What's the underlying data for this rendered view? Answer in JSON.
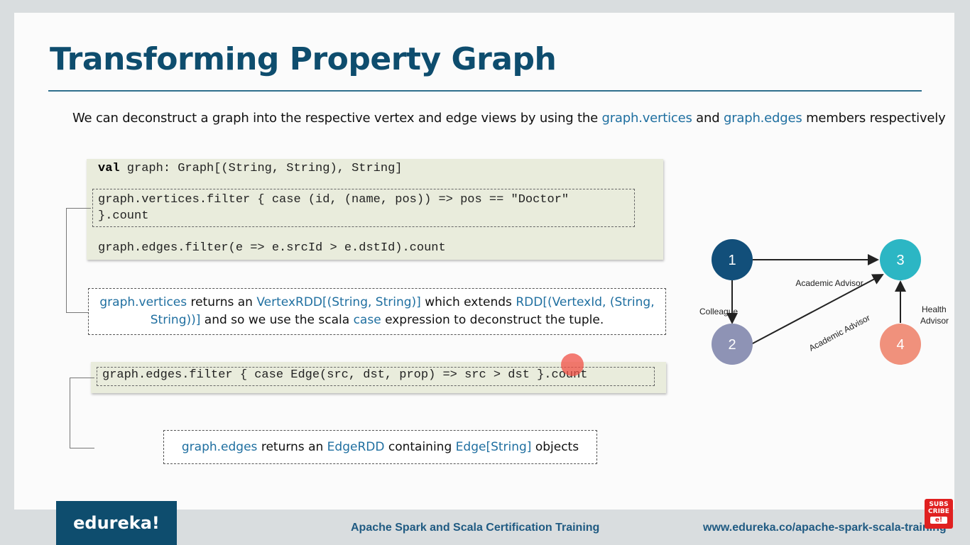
{
  "slide": {
    "title": "Transforming Property Graph",
    "intro": {
      "part1": "We can deconstruct a graph into the respective vertex and edge views by using the ",
      "link1": "graph.vertices",
      "part2": " and ",
      "link2": "graph.edges",
      "part3": " members respectively"
    },
    "code_block_1": {
      "line1_kw": "val",
      "line1_rest": " graph: Graph[(String, String), String]",
      "line2": "graph.vertices.filter { case (id, (name, pos)) => pos == \"Doctor\"",
      "line3": "}.count",
      "line4": "graph.edges.filter(e => e.srcId > e.dstId).count"
    },
    "note_1": {
      "t1": "graph.vertices",
      "t2": " returns an ",
      "t3": "VertexRDD[(String, String)]",
      "t4": " which extends ",
      "t5": "RDD[(VertexId, (String,",
      "t6": "String))]",
      "t7": " and so we use the scala ",
      "t8": "case",
      "t9": " expression to deconstruct the tuple."
    },
    "code_block_2": {
      "line1": "graph.edges.filter { case Edge(src, dst, prop) => src > dst }.count"
    },
    "note_2": {
      "t1": "graph.edges",
      "t2": " returns an ",
      "t3": "EdgeRDD",
      "t4": " containing ",
      "t5": "Edge[String]",
      "t6": " objects"
    },
    "graph": {
      "nodes": [
        {
          "label": "1",
          "color": "#124f7a"
        },
        {
          "label": "2",
          "color": "#8e93b5"
        },
        {
          "label": "3",
          "color": "#2cb6c4"
        },
        {
          "label": "4",
          "color": "#f0917c"
        }
      ],
      "edge_labels": {
        "e13": "Academic Advisor",
        "e12": "Colleague",
        "e23": "Academic Advisor",
        "e43_line1": "Health",
        "e43_line2": "Advisor"
      }
    }
  },
  "footer": {
    "logo": "edureka!",
    "course": "Apache Spark and Scala Certification Training",
    "url": "www.edureka.co/apache-spark-scala-training",
    "subscribe_line1": "SUBS",
    "subscribe_line2": "CRIBE",
    "subscribe_line3": "e!"
  }
}
